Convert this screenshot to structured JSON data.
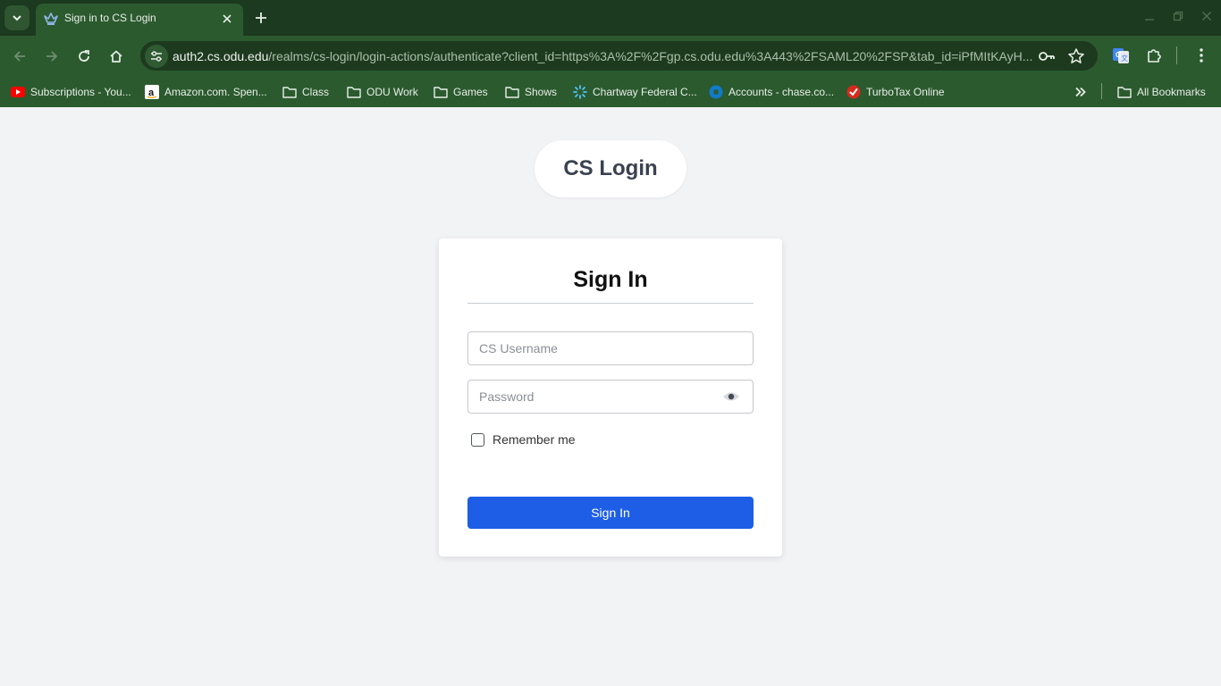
{
  "browser": {
    "tab": {
      "title": "Sign in to CS Login"
    },
    "url": {
      "host": "auth2.cs.odu.edu",
      "path": "/realms/cs-login/login-actions/authenticate?client_id=https%3A%2F%2Fgp.cs.odu.edu%3A443%2FSAML20%2FSP&tab_id=iPfMItKAyH..."
    },
    "bookmarks": [
      {
        "label": "Subscriptions - You...",
        "icon": "youtube-icon"
      },
      {
        "label": "Amazon.com. Spen...",
        "icon": "amazon-icon"
      },
      {
        "label": "Class",
        "icon": "folder-icon"
      },
      {
        "label": "ODU Work",
        "icon": "folder-icon"
      },
      {
        "label": "Games",
        "icon": "folder-icon"
      },
      {
        "label": "Shows",
        "icon": "folder-icon"
      },
      {
        "label": "Chartway Federal C...",
        "icon": "chartway-icon"
      },
      {
        "label": "Accounts - chase.co...",
        "icon": "chase-icon"
      },
      {
        "label": "TurboTax Online",
        "icon": "turbotax-icon"
      }
    ],
    "all_bookmarks": "All Bookmarks",
    "colors": {
      "frame": "#1c3a1f",
      "toolbar": "#2b5a2e"
    }
  },
  "page": {
    "brand": "CS Login",
    "heading": "Sign In",
    "username_placeholder": "CS Username",
    "password_placeholder": "Password",
    "remember_label": "Remember me",
    "submit_label": "Sign In",
    "colors": {
      "primary": "#1e5ee6",
      "background": "#f2f3f5"
    }
  }
}
